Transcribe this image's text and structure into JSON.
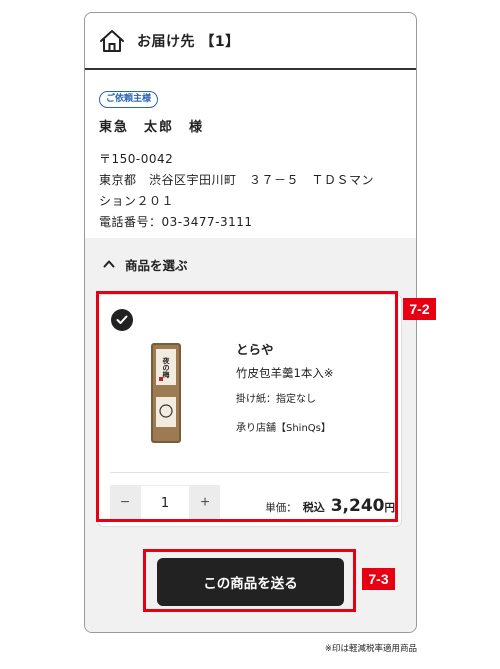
{
  "header": {
    "title": "お届け先 【1】",
    "icon": "home-icon"
  },
  "address": {
    "badge": "ご依頼主様",
    "recipient": "東急　太郎　様",
    "postal": "〒150-0042",
    "line1": "東京都　渋谷区宇田川町　３７－５　ＴＤＳマン",
    "line2": "ション２０１",
    "phone": "電話番号：03-3477-3111"
  },
  "product_section": {
    "toggle_label": "商品を選ぶ",
    "product": {
      "brand": "とらや",
      "name": "竹皮包羊羹1本入※",
      "noshi": "掛け紙：指定なし",
      "shop": "承り店舗【ShinQs】",
      "package_text": "夜の梅",
      "quantity": "1",
      "minus": "−",
      "plus": "+",
      "price_label": "単価：",
      "tax_label": "税込",
      "price": "3,240",
      "currency": "円"
    },
    "send_button": "この商品を送る"
  },
  "annotations": {
    "tag_product": "7-2",
    "tag_button": "7-3"
  },
  "footnote": "※印は軽減税率適用商品",
  "colors": {
    "badge": "#2a64b5",
    "highlight": "#e60012",
    "button": "#222222",
    "section_bg": "#f1f1f1"
  }
}
